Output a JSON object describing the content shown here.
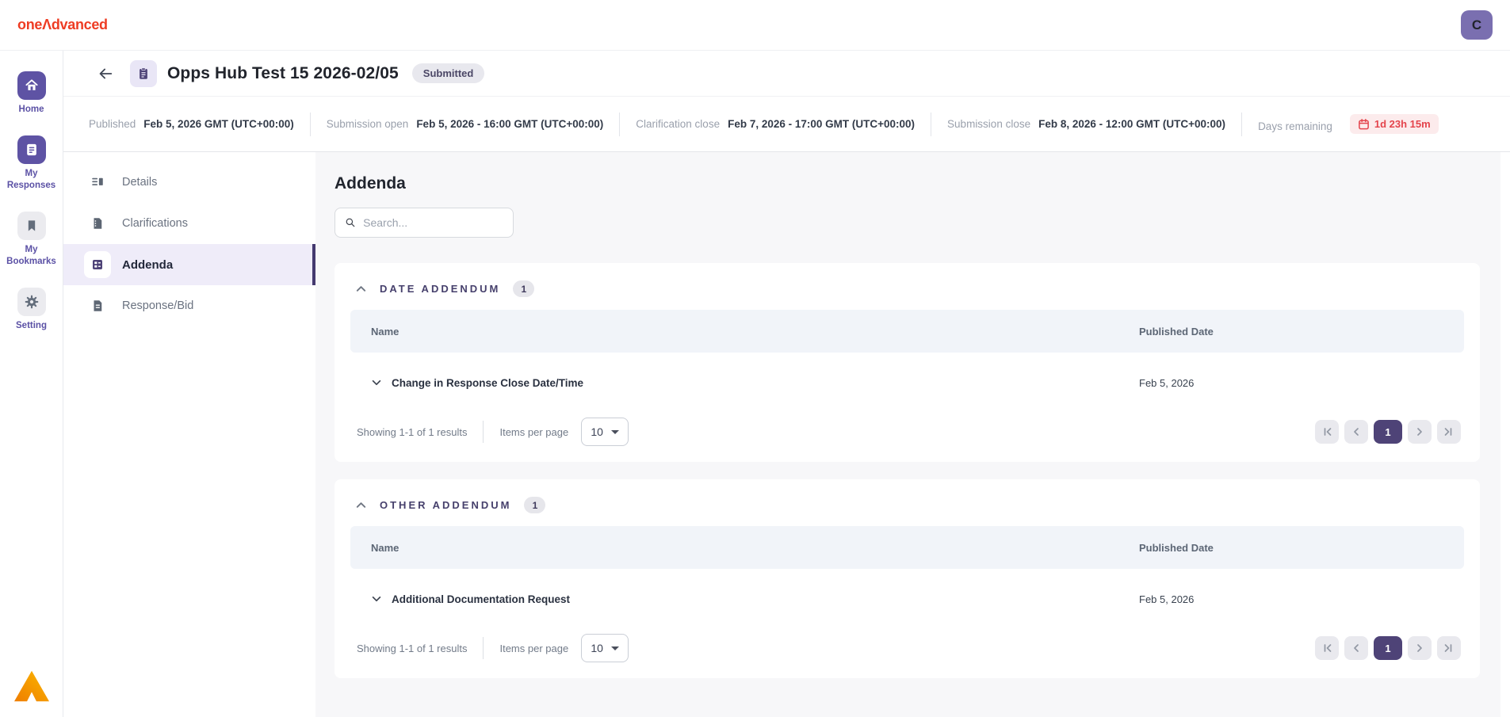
{
  "header": {
    "logo": {
      "one": "one",
      "mark": "Λ",
      "rest": "dvanced"
    },
    "avatar_initial": "C"
  },
  "sidebar": {
    "items": [
      {
        "label": "Home",
        "icon": "home-icon",
        "active": true
      },
      {
        "label": "My Responses",
        "icon": "responses-icon",
        "active": true
      },
      {
        "label": "My Bookmarks",
        "icon": "bookmark-icon",
        "active": false
      },
      {
        "label": "Setting",
        "icon": "gear-icon",
        "active": false
      }
    ]
  },
  "page": {
    "title": "Opps Hub Test 15 2026-02/05",
    "status": "Submitted",
    "meta": [
      {
        "label": "Published",
        "value": "Feb 5, 2026 GMT (UTC+00:00)"
      },
      {
        "label": "Submission open",
        "value": "Feb 5, 2026 - 16:00 GMT (UTC+00:00)"
      },
      {
        "label": "Clarification close",
        "value": "Feb 7, 2026 - 17:00 GMT (UTC+00:00)"
      },
      {
        "label": "Submission close",
        "value": "Feb 8, 2026 - 12:00 GMT (UTC+00:00)"
      }
    ],
    "days_remaining": {
      "label": "Days remaining",
      "value": "1d 23h 15m"
    }
  },
  "nav": {
    "items": [
      {
        "label": "Details"
      },
      {
        "label": "Clarifications"
      },
      {
        "label": "Addenda",
        "active": true
      },
      {
        "label": "Response/Bid"
      }
    ]
  },
  "main": {
    "title": "Addenda",
    "search_placeholder": "Search...",
    "sections": [
      {
        "title": "DATE ADDENDUM",
        "count": "1",
        "columns": {
          "name": "Name",
          "date": "Published Date"
        },
        "rows": [
          {
            "name": "Change in Response Close Date/Time",
            "date": "Feb 5, 2026"
          }
        ],
        "pagination": {
          "showing": "Showing 1-1 of 1 results",
          "items_per_page_label": "Items per page",
          "page_size": "10",
          "current_page": "1"
        }
      },
      {
        "title": "OTHER ADDENDUM",
        "count": "1",
        "columns": {
          "name": "Name",
          "date": "Published Date"
        },
        "rows": [
          {
            "name": "Additional Documentation Request",
            "date": "Feb 5, 2026"
          }
        ],
        "pagination": {
          "showing": "Showing 1-1 of 1 results",
          "items_per_page_label": "Items per page",
          "page_size": "10",
          "current_page": "1"
        }
      }
    ]
  },
  "colors": {
    "brand_orange": "#ee3c23",
    "primary_purple": "#5e53a4",
    "dark_purple": "#4e4377",
    "selected_nav_bg": "#efecf9",
    "danger_red": "#e4444c",
    "danger_bg": "#fcebec",
    "content_bg": "#f7f7f9",
    "table_header_bg": "#f1f4f9"
  }
}
